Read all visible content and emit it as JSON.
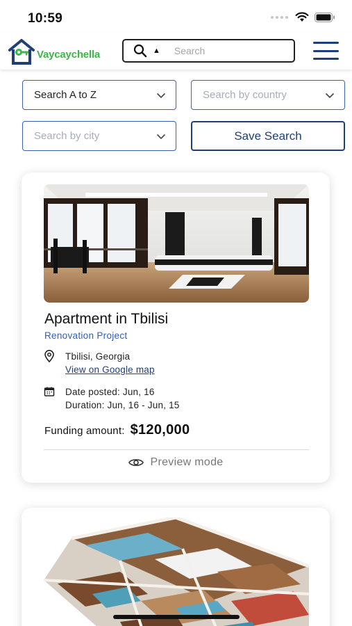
{
  "status_bar": {
    "time": "10:59"
  },
  "header": {
    "logo_text": "Vaycaychella",
    "search_placeholder": "Search",
    "icons": [
      "search-icon",
      "caret-up-icon",
      "hamburger-menu-icon"
    ]
  },
  "filters": {
    "sort_select": "Search A to Z",
    "country_placeholder": "Search by country",
    "city_placeholder": "Search by city",
    "save_button": "Save Search"
  },
  "listings": [
    {
      "title": "Apartment in Tbilisi",
      "subtitle": "Renovation Project",
      "location": "Tbilisi, Georgia",
      "map_link": "View on Google map",
      "date_posted": "Date posted: Jun, 16",
      "duration": "Duration: Jun, 16 - Jun, 15",
      "funding_label": "Funding amount:",
      "funding_value": "$120,000",
      "preview_label": "Preview mode"
    }
  ],
  "colors": {
    "brand_green": "#3db64a",
    "navy": "#1e3f7a",
    "link_blue": "#2f5fb3",
    "field_border": "#3d5fb8"
  }
}
